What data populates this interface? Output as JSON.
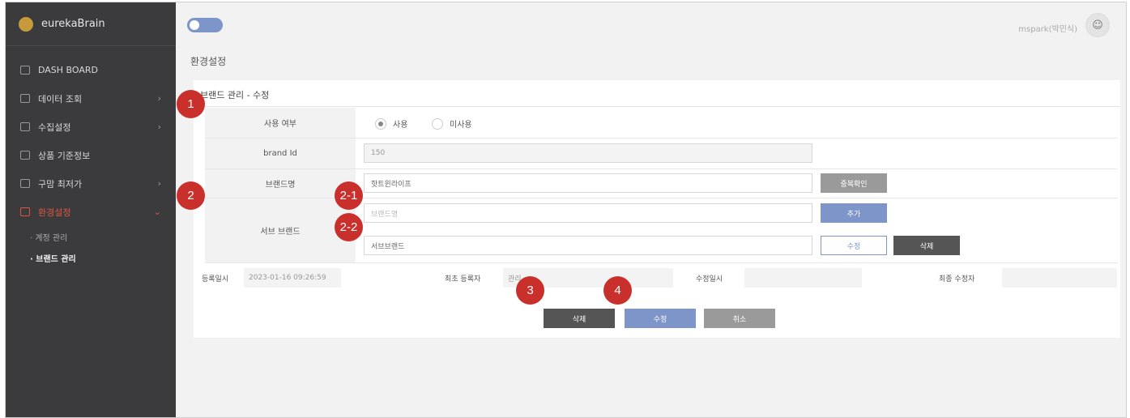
{
  "sidebar": {
    "brand": "eurekaBrain",
    "items": [
      {
        "label": "DASH BOARD",
        "icon": "dashboard-icon"
      },
      {
        "label": "데이터 조회",
        "icon": "search-icon"
      },
      {
        "label": "수집설정",
        "icon": "monitor-icon"
      },
      {
        "label": "상품 기준정보",
        "icon": "list-icon"
      },
      {
        "label": "구맘 최저가",
        "icon": "list-icon"
      },
      {
        "label": "환경설정",
        "icon": "gear-icon"
      }
    ],
    "sub_items": [
      {
        "label": "· 계정 관리"
      },
      {
        "label": "· 브랜드 관리"
      }
    ]
  },
  "header": {
    "user": "mspark(박민식)",
    "avatar_icon": "user-icon"
  },
  "page_title": "환경설정",
  "form": {
    "title": "브랜드 관리 - 수정",
    "use_label": "사용 여부",
    "use_options": [
      "사용",
      "미사용"
    ],
    "use_selected": "사용",
    "brand_id_label": "brand Id",
    "brand_id_value": "150",
    "brand_name_label": "브랜드명",
    "brand_name_value": "핫트윈라이프",
    "dup_check_button": "중복확인",
    "sub_brand_label": "서브 브랜드",
    "sub_brand_placeholder": "브랜드명",
    "add_button": "추가",
    "sub_brand_value": "서브브랜드",
    "edit_button": "수정",
    "delete_button": "삭제"
  },
  "meta": {
    "reg_date_label": "등록일시",
    "reg_date_value": "2023-01-16 09:26:59",
    "first_reg_label": "최초 등록자",
    "first_reg_value": "관리",
    "mod_date_label": "수정일시",
    "mod_date_value": "",
    "last_mod_label": "최종 수정자",
    "last_mod_value": ""
  },
  "actions": {
    "delete": "삭제",
    "save": "수정",
    "cancel": "취소"
  },
  "markers": [
    "1",
    "2",
    "2-1",
    "2-2",
    "3",
    "4"
  ],
  "colors": {
    "sidebar_bg": "#3b3b3d",
    "accent_red": "#c9302c",
    "active_menu": "#e0543f",
    "blue_button": "#7d95c9",
    "dark_button": "#555555",
    "gray_button": "#9a9a9a"
  }
}
